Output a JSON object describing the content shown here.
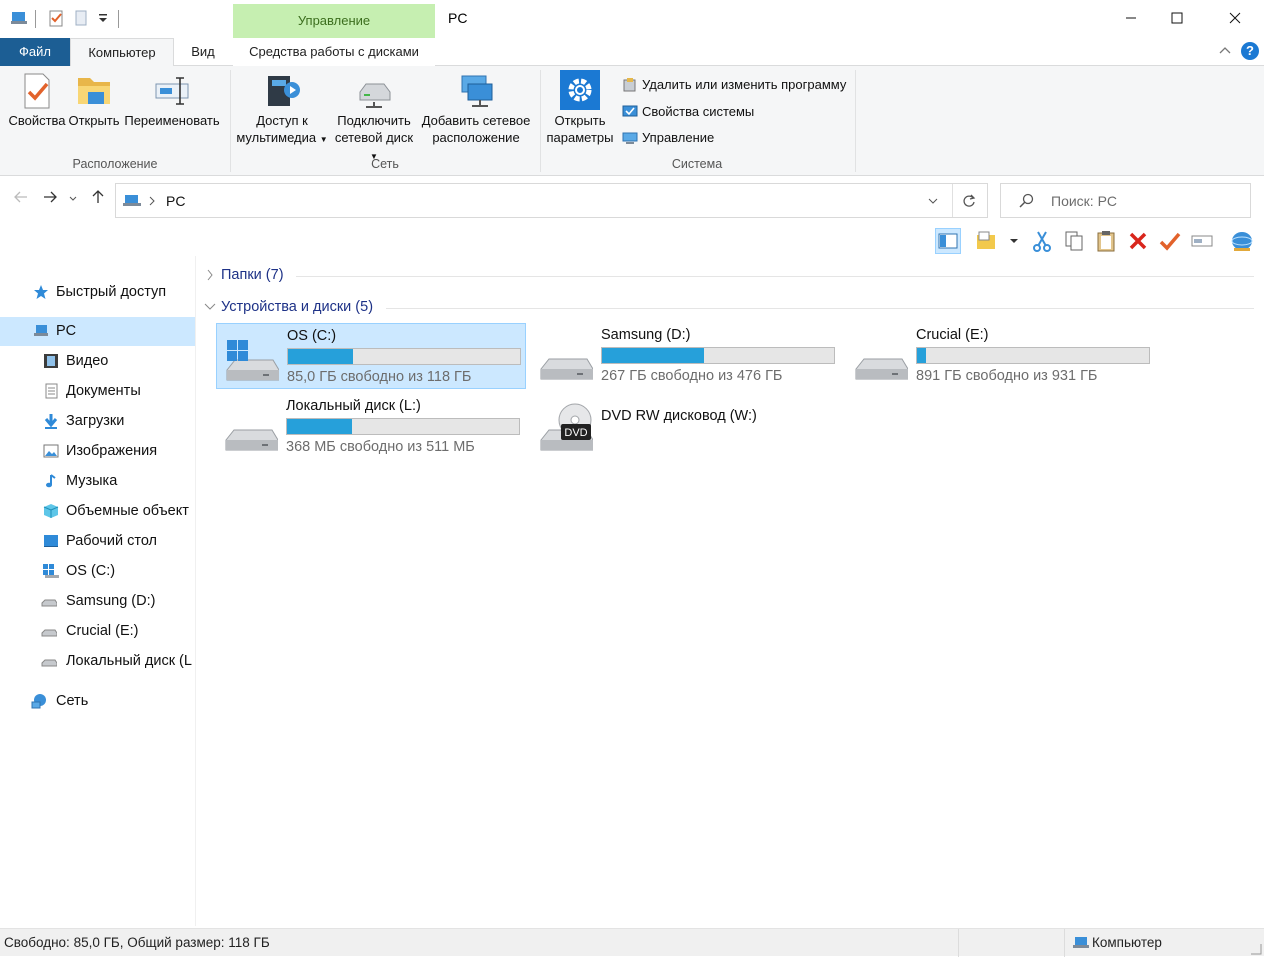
{
  "window": {
    "title": "PC",
    "context_tab_header": "Управление"
  },
  "tabs": {
    "file": "Файл",
    "computer": "Компьютер",
    "view": "Вид",
    "disk_tools": "Средства работы с дисками"
  },
  "ribbon": {
    "location": {
      "label": "Расположение",
      "properties": "Свойства",
      "open": "Открыть",
      "rename": "Переименовать"
    },
    "network": {
      "label": "Сеть",
      "media_access_1": "Доступ к",
      "media_access_2": "мультимедиа",
      "map_drive_1": "Подключить",
      "map_drive_2": "сетевой диск",
      "add_location_1": "Добавить сетевое",
      "add_location_2": "расположение"
    },
    "system": {
      "label": "Система",
      "open_settings_1": "Открыть",
      "open_settings_2": "параметры",
      "uninstall": "Удалить или изменить программу",
      "system_props": "Свойства системы",
      "manage": "Управление"
    }
  },
  "address": {
    "path": "PC",
    "search_placeholder": "Поиск: PC"
  },
  "nav_pane": {
    "quick_access": "Быстрый доступ",
    "pc": "PC",
    "items": [
      "Видео",
      "Документы",
      "Загрузки",
      "Изображения",
      "Музыка",
      "Объемные объект",
      "Рабочий стол",
      "OS (C:)",
      "Samsung (D:)",
      "Crucial (E:)",
      "Локальный диск (L"
    ],
    "network": "Сеть"
  },
  "main": {
    "folders_header": "Папки (7)",
    "devices_header": "Устройства и диски (5)",
    "drives": [
      {
        "name": "OS (C:)",
        "free": "85,0 ГБ свободно из 118 ГБ",
        "used_fraction": 0.28
      },
      {
        "name": "Samsung (D:)",
        "free": "267 ГБ свободно из 476 ГБ",
        "used_fraction": 0.44
      },
      {
        "name": "Crucial (E:)",
        "free": "891 ГБ свободно из 931 ГБ",
        "used_fraction": 0.04
      },
      {
        "name": "Локальный диск (L:)",
        "free": "368 МБ свободно из 511 МБ",
        "used_fraction": 0.28
      }
    ],
    "dvd": {
      "name": "DVD RW дисковод (W:)",
      "badge": "DVD"
    }
  },
  "status": {
    "left": "Свободно: 85,0 ГБ, Общий размер: 118 ГБ",
    "right": "Компьютер"
  },
  "colors": {
    "accent": "#1c5e94",
    "selection": "#cce8ff",
    "bar_fill": "#26a0da",
    "context_tab": "#c6efb1"
  }
}
